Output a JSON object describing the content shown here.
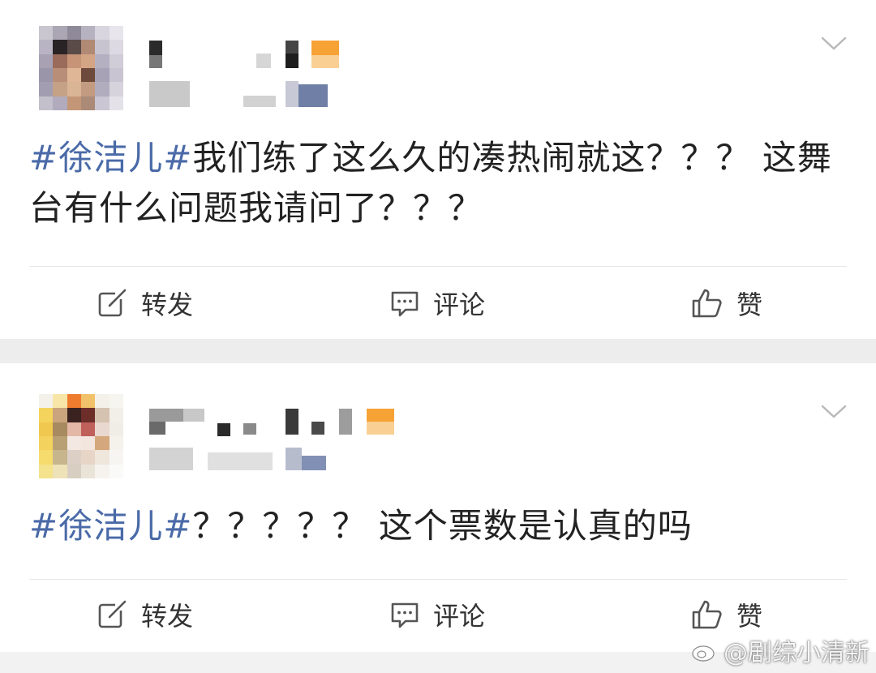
{
  "posts": [
    {
      "hashtag": "#徐洁儿#",
      "text": "我们练了这么久的凑热闹就这？？？ 这舞台有什么问题我请问了？？？",
      "actions": {
        "repost": "转发",
        "comment": "评论",
        "like": "赞"
      }
    },
    {
      "hashtag": "#徐洁儿#",
      "text": "？？？？？ 这个票数是认真的吗",
      "actions": {
        "repost": "转发",
        "comment": "评论",
        "like": "赞"
      }
    }
  ],
  "watermark": {
    "text": "@剧综小清新"
  },
  "colors": {
    "hashtag": "#4a6aa8",
    "text": "#222222",
    "icon": "#555555",
    "background": "#f2f2f2"
  },
  "icons": [
    "repost-icon",
    "comment-icon",
    "like-icon",
    "chevron-down-icon",
    "weibo-logo-icon"
  ]
}
